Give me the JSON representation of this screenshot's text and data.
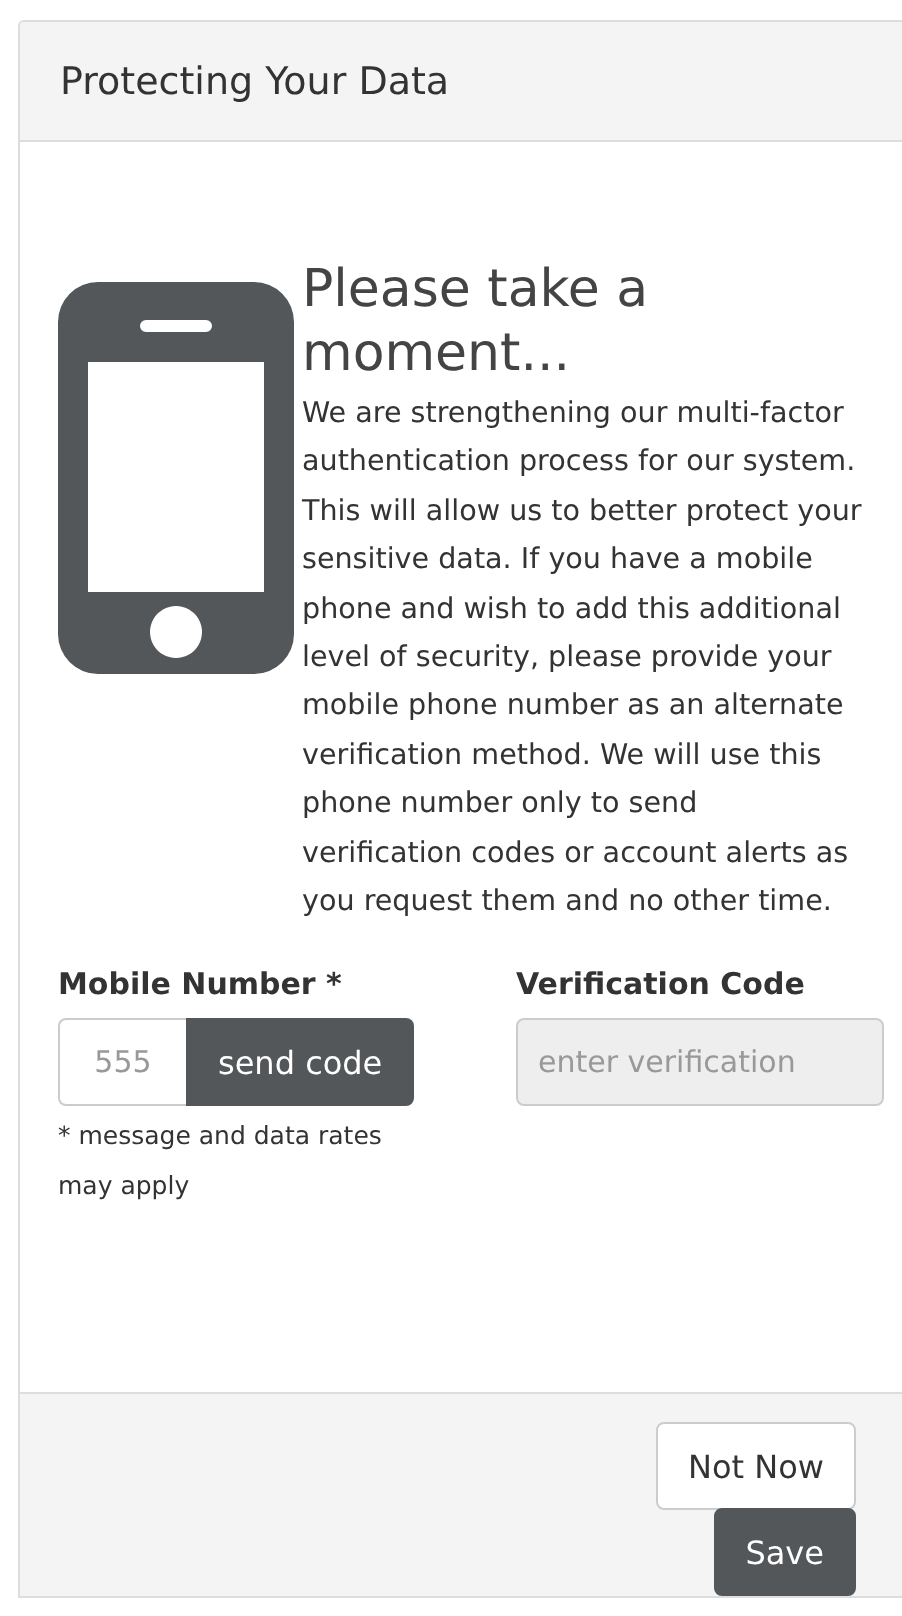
{
  "panel": {
    "title": "Protecting Your Data"
  },
  "intro": {
    "heading": "Please take a moment...",
    "text": "We are strengthening our multi-factor authentication process for our system. This will allow us to better protect your sensitive data. If you have a mobile phone and wish to add this additional level of security, please provide your mobile phone number as an alternate verification method. We will use this phone number only to send verification codes or account alerts as you request them and no other time."
  },
  "mobile": {
    "label": "Mobile Number *",
    "placeholder": "555",
    "button": "send code",
    "note": "* message and data rates may apply"
  },
  "verification": {
    "label": "Verification Code",
    "placeholder": "enter verification",
    "disabled": true
  },
  "buttons": [
    {
      "label": "Not Now",
      "kind": "secondary"
    },
    {
      "label": "Save",
      "kind": "primary"
    }
  ]
}
